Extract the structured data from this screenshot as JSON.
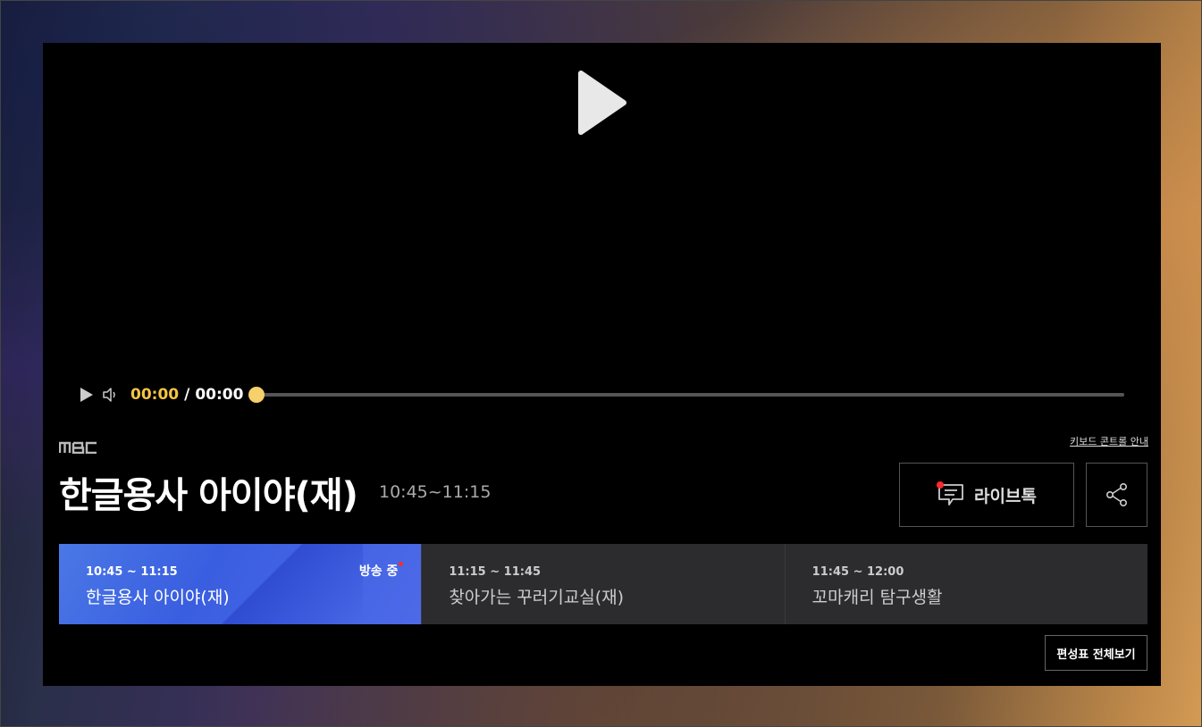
{
  "brand": {
    "logo_text": "MBC"
  },
  "player": {
    "current_time": "00:00",
    "separator": "/",
    "total_time": "00:00",
    "progress": 0.0,
    "accent_color": "#f5c542"
  },
  "header": {
    "keyboard_guide": "키보드 콘트롤 안내",
    "program_title": "한글용사 아이야(재)",
    "program_time": "10:45~11:15",
    "livetalk_label": "라이브톡"
  },
  "schedule": {
    "items": [
      {
        "time": "10:45 ~ 11:15",
        "name": "한글용사 아이야(재)",
        "status": "방송 중",
        "active": true
      },
      {
        "time": "11:15 ~ 11:45",
        "name": "찾아가는 꾸러기교실(재)",
        "active": false
      },
      {
        "time": "11:45 ~ 12:00",
        "name": "꼬마캐리 탐구생활",
        "active": false
      }
    ],
    "full_schedule_label": "편성표 전체보기"
  },
  "icons": {
    "big_play": "play-icon",
    "ctrl_play": "play-icon",
    "volume": "volume-icon",
    "livetalk": "chat-icon",
    "share": "share-icon"
  }
}
